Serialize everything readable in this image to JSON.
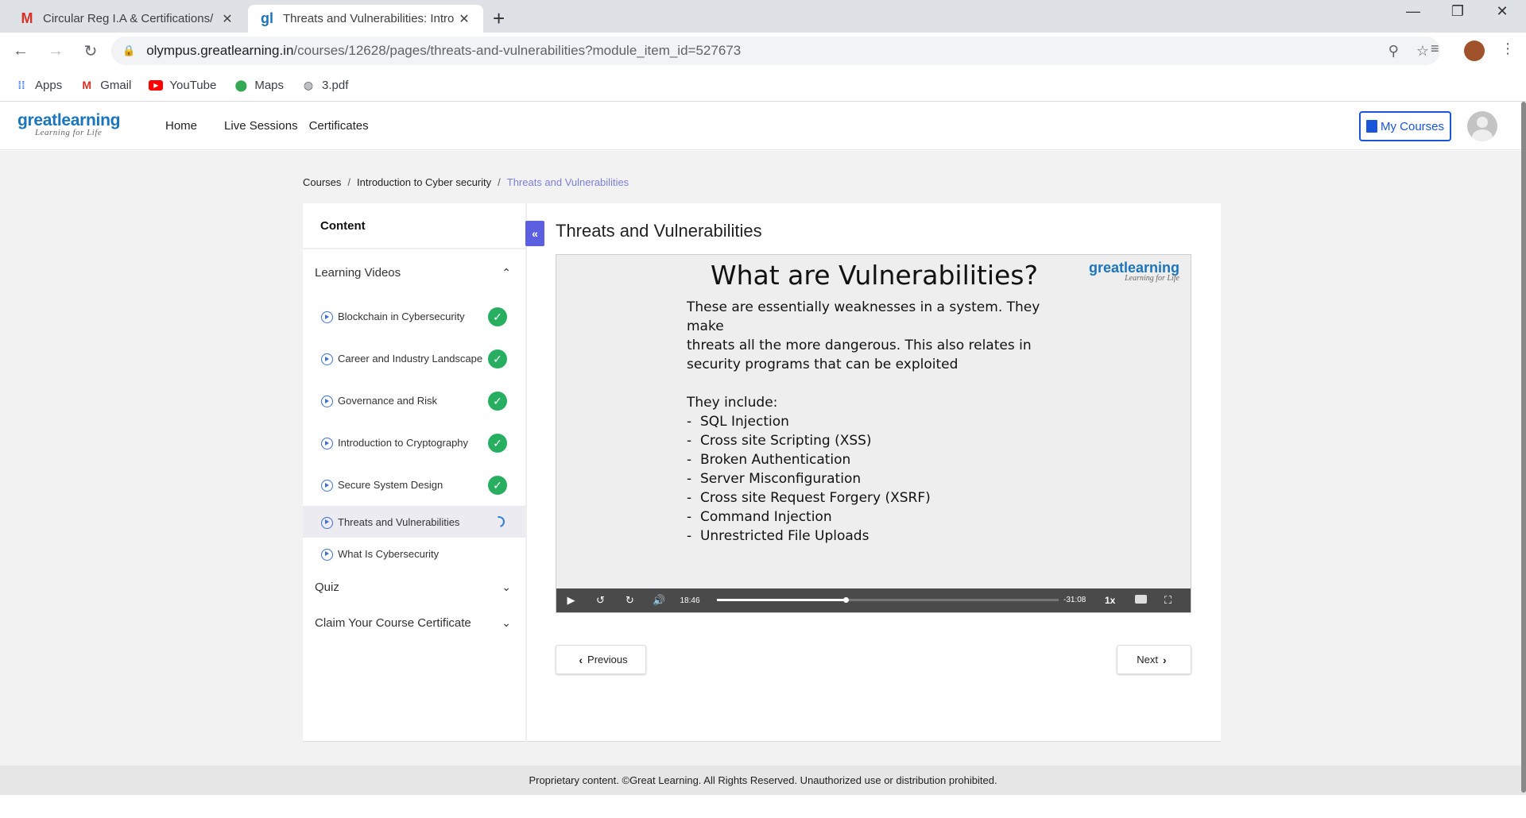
{
  "browser": {
    "tabs": [
      {
        "title": "Circular Reg I.A & Certifications/",
        "favicon": "gmail-icon"
      },
      {
        "title": "Threats and Vulnerabilities: Intro",
        "favicon": "greatlearning-icon"
      }
    ],
    "url_host": "olympus.greatlearning.in",
    "url_path": "/courses/12628/pages/threats-and-vulnerabilities?module_item_id=527673",
    "bookmarks": [
      "Apps",
      "Gmail",
      "YouTube",
      "Maps",
      "3.pdf"
    ]
  },
  "site": {
    "logo_main": "greatlearning",
    "logo_tagline": "Learning for Life",
    "nav": [
      "Home",
      "Live Sessions",
      "Certificates"
    ],
    "my_courses": "My Courses"
  },
  "breadcrumb": {
    "items": [
      "Courses",
      "Introduction to Cyber security"
    ],
    "current": "Threats and Vulnerabilities"
  },
  "sidebar": {
    "header": "Content",
    "section_learning": "Learning Videos",
    "items": [
      {
        "label": "Blockchain in Cybersecurity",
        "status": "complete"
      },
      {
        "label": "Career and Industry Landscape",
        "status": "complete"
      },
      {
        "label": "Governance and Risk",
        "status": "complete"
      },
      {
        "label": "Introduction to Cryptography",
        "status": "complete"
      },
      {
        "label": "Secure System Design",
        "status": "complete"
      },
      {
        "label": "Threats and Vulnerabilities",
        "status": "in-progress"
      },
      {
        "label": "What Is Cybersecurity",
        "status": "none"
      }
    ],
    "section_quiz": "Quiz",
    "section_certificate": "Claim Your Course Certificate"
  },
  "content": {
    "title": "Threats and Vulnerabilities",
    "slide": {
      "title": "What are Vulnerabilities?",
      "logo_main": "greatlearning",
      "logo_tagline": "Learning for Life",
      "intro": [
        "These are essentially weaknesses in a system. They make",
        "threats all the more dangerous. This also relates in",
        "security programs that can be exploited"
      ],
      "list_heading": "They include:",
      "bullets": [
        "SQL Injection",
        "Cross site Scripting (XSS)",
        "Broken Authentication",
        "Server Misconfiguration",
        "Cross site Request Forgery (XSRF)",
        "Command Injection",
        "Unrestricted File Uploads"
      ]
    },
    "player": {
      "elapsed": "18:46",
      "remaining": "-31:08",
      "speed": "1x",
      "progress": 0.376
    },
    "prev_label": "Previous",
    "next_label": "Next"
  },
  "footer": "Proprietary content. ©Great Learning. All Rights Reserved. Unauthorized use or distribution prohibited."
}
